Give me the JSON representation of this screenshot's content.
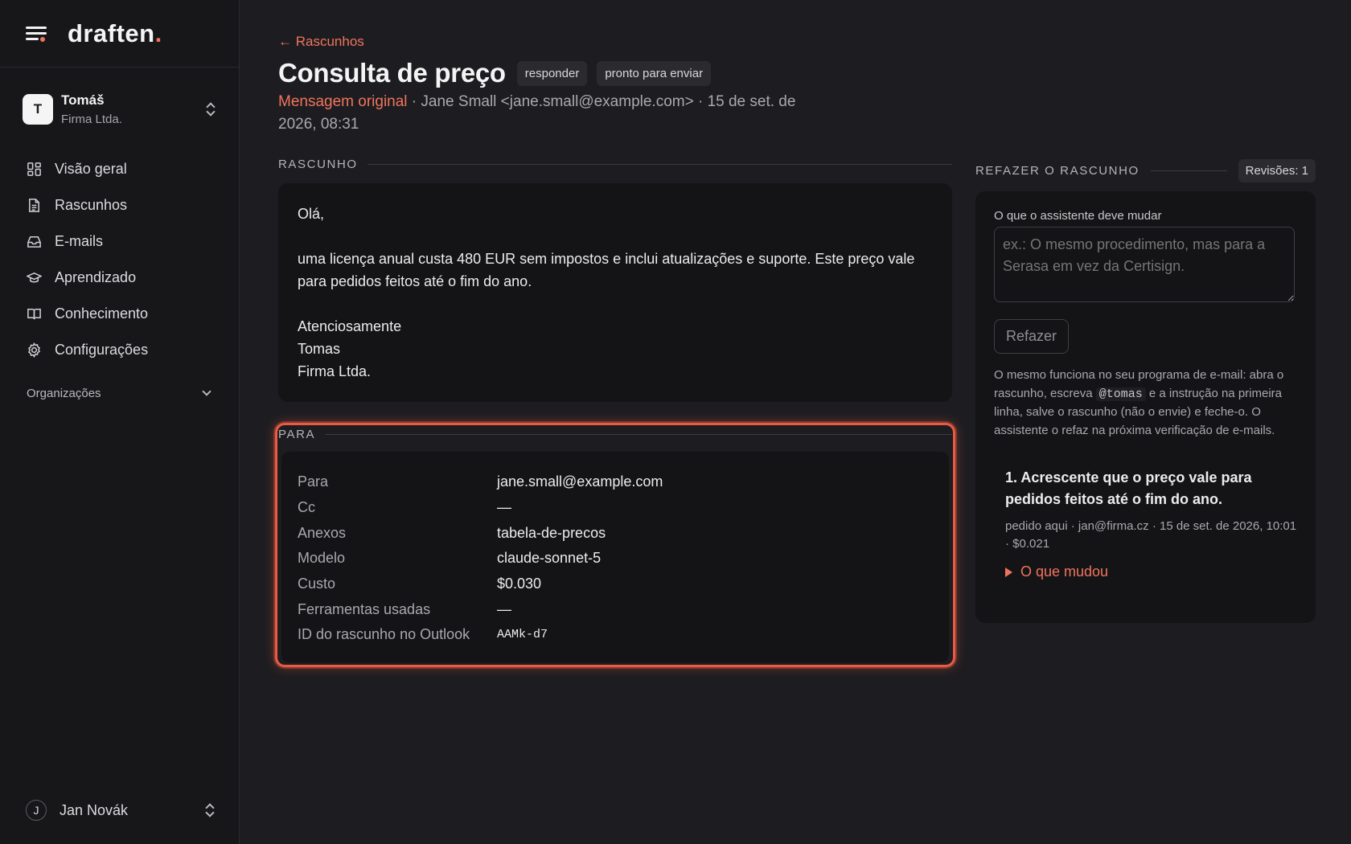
{
  "app": {
    "logo_text": "draften",
    "logo_dot": "."
  },
  "account": {
    "initial": "T",
    "name": "Tomáš",
    "org": "Firma Ltda."
  },
  "nav": [
    {
      "label": "Visão geral",
      "icon": "grid-icon"
    },
    {
      "label": "Rascunhos",
      "icon": "document-icon"
    },
    {
      "label": "E-mails",
      "icon": "inbox-icon"
    },
    {
      "label": "Aprendizado",
      "icon": "graduation-cap-icon"
    },
    {
      "label": "Conhecimento",
      "icon": "book-icon"
    },
    {
      "label": "Configurações",
      "icon": "gear-icon"
    }
  ],
  "organizations": {
    "label": "Organizações"
  },
  "user": {
    "initial": "J",
    "name": "Jan Novák"
  },
  "header": {
    "back_label": "← Rascunhos",
    "title": "Consulta de preço",
    "badges": [
      "responder",
      "pronto para enviar"
    ],
    "original_label": "Mensagem original",
    "meta_text": " · Jane Small <jane.small@example.com> · 15 de set. de 2026, 08:31"
  },
  "draft": {
    "section_label": "Rascunho",
    "greeting": "Olá,",
    "body": "uma licença anual custa 480 EUR sem impostos e inclui atualizações e suporte. Este preço vale para pedidos feitos até o fim do ano.",
    "closing": "Atenciosamente",
    "signature_name": "Tomas",
    "signature_org": "Firma Ltda."
  },
  "para": {
    "section_label": "Para",
    "rows": [
      {
        "key": "Para",
        "value": "jane.small@example.com"
      },
      {
        "key": "Cc",
        "value": "—"
      },
      {
        "key": "Anexos",
        "value": "tabela-de-precos"
      },
      {
        "key": "Modelo",
        "value": "claude-sonnet-5"
      },
      {
        "key": "Custo",
        "value": "$0.030"
      },
      {
        "key": "Ferramentas usadas",
        "value": "—"
      },
      {
        "key": "ID do rascunho no Outlook",
        "value": "AAMk-d7"
      }
    ]
  },
  "redo": {
    "section_label": "Refazer o rascunho",
    "revisions_badge": "Revisões: 1",
    "field_label": "O que o assistente deve mudar",
    "placeholder": "ex.: O mesmo procedimento, mas para a Serasa em vez da Certisign.",
    "button_label": "Refazer",
    "help_before": "O mesmo funciona no seu programa de e-mail: abra o rascunho, escreva ",
    "help_code": "@tomas",
    "help_after": " e a instrução na primeira linha, salve o rascunho (não o envie) e feche-o. O assistente o refaz na próxima verificação de e-mails.",
    "revision": {
      "title": "1. Acrescente que o preço vale para pedidos feitos até o fim do ano.",
      "meta": "pedido aqui · jan@firma.cz · 15 de set. de 2026, 10:01 · $0.021",
      "toggle_label": "O que mudou"
    }
  },
  "colors": {
    "accent": "#f0745c",
    "background": "#1d1d21",
    "sidebar": "#17171a",
    "card": "#141417",
    "highlight": "#ec5a42"
  }
}
